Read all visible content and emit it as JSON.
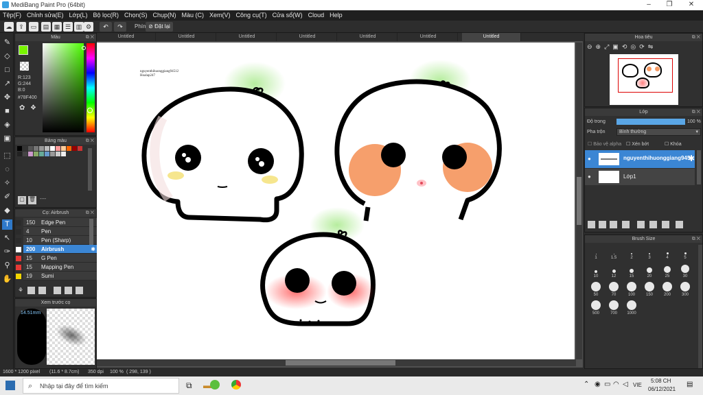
{
  "window": {
    "title": "MediBang Paint Pro (64bit)"
  },
  "menu": [
    "Tệp(F)",
    "Chỉnh sửa(E)",
    "Lớp(L)",
    "Bộ lọc(R)",
    "Chọn(S)",
    "Chụp(N)",
    "Màu (C)",
    "Xem(V)",
    "Công cụ(T)",
    "Cửa sổ(W)",
    "Cloud",
    "Help"
  ],
  "toolbar": {
    "phim_label": "Phím",
    "reset_label": "Đặt lại"
  },
  "tabs": [
    "Untitled",
    "Untitled",
    "Untitled",
    "Untitled",
    "Untitled",
    "Untitled",
    "Untitled"
  ],
  "color_panel": {
    "title": "Màu",
    "r": "R:123",
    "g": "G:244",
    "b": "B:0",
    "hex": "#78F400",
    "primary": "#78F400"
  },
  "palette_panel": {
    "title": "Bảng màu",
    "palette_name": "----"
  },
  "brush_panel": {
    "title": "Cọ: Airbrush",
    "brushes": [
      {
        "size": "150",
        "name": "Edge Pen",
        "color": "#2b2b2b"
      },
      {
        "size": "4",
        "name": "Pen",
        "color": "#2b2b2b"
      },
      {
        "size": "10",
        "name": "Pen (Sharp)",
        "color": "#2b2b2b"
      },
      {
        "size": "200",
        "name": "Airbrush",
        "color": "#ffffff"
      },
      {
        "size": "15",
        "name": "G Pen",
        "color": "#e53935"
      },
      {
        "size": "15",
        "name": "Mapping Pen",
        "color": "#e53935"
      },
      {
        "size": "19",
        "name": "Sumi",
        "color": "#f2d600"
      }
    ]
  },
  "preview_panel": {
    "title": "Xem trước cọ",
    "size": "14.51mm"
  },
  "navigator": {
    "title": "Hoa tiêu"
  },
  "layer_panel": {
    "title": "Lớp",
    "opacity_label": "Độ trong",
    "opacity_value": "100 %",
    "blend_label": "Pha trộn",
    "blend_value": "Bình thường",
    "protect_alpha": "Bảo vệ alpha",
    "clip": "Xén bớt",
    "lock": "Khóa",
    "layers": [
      {
        "name": "nguyenthihuonggiang94512"
      },
      {
        "name": "Lớp1"
      }
    ]
  },
  "brush_size_panel": {
    "title": "Brush Size",
    "sizes": [
      "1",
      "1.5",
      "2",
      "3",
      "4",
      "5",
      "10",
      "12",
      "15",
      "20",
      "25",
      "30",
      "50",
      "70",
      "100",
      "150",
      "200",
      "300",
      "500",
      "700",
      "1000"
    ]
  },
  "canvas": {
    "signature_line1": "nguyenthihuonggiang94512",
    "signature_line2": "Hoalap247"
  },
  "status": {
    "dimensions": "1600 * 1200 pixel",
    "size_cm": "(11.6 * 8.7cm)",
    "dpi": "350 dpi",
    "zoom": "100 %",
    "coords": "( 298, 139 )"
  },
  "taskbar": {
    "search_placeholder": "Nhập tại đây để tìm kiếm",
    "lang": "VIE",
    "time": "5:08 CH",
    "date": "06/12/2021"
  }
}
